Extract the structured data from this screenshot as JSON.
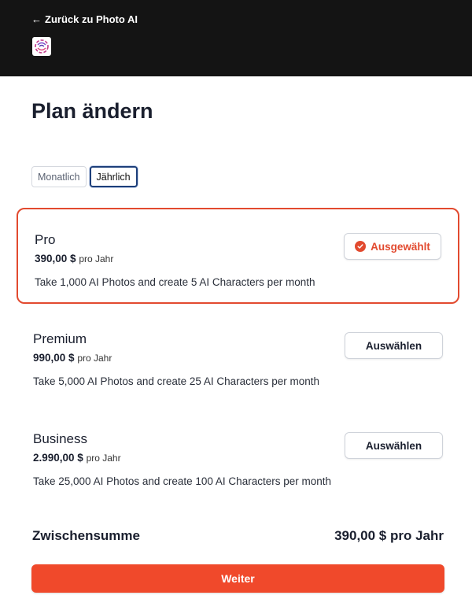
{
  "header": {
    "back_arrow": "←",
    "back_label": "Zurück zu Photo AI",
    "logo_icon": "photo-ai-logo"
  },
  "page": {
    "title": "Plan ändern"
  },
  "billing_toggle": {
    "monthly": "Monatlich",
    "yearly": "Jährlich",
    "selected": "yearly"
  },
  "plans": [
    {
      "name": "Pro",
      "price": "390,00 $",
      "period": "pro Jahr",
      "description": "Take 1,000 AI Photos and create 5 AI Characters per month",
      "button_label": "Ausgewählt",
      "selected": true
    },
    {
      "name": "Premium",
      "price": "990,00 $",
      "period": "pro Jahr",
      "description": "Take 5,000 AI Photos and create 25 AI Characters per month",
      "button_label": "Auswählen",
      "selected": false
    },
    {
      "name": "Business",
      "price": "2.990,00 $",
      "period": "pro Jahr",
      "description": "Take 25,000 AI Photos and create 100 AI Characters per month",
      "button_label": "Auswählen",
      "selected": false
    }
  ],
  "summary": {
    "subtotal_label": "Zwischensumme",
    "subtotal_value": "390,00 $ pro Jahr"
  },
  "actions": {
    "continue_label": "Weiter"
  },
  "colors": {
    "accent": "#f0492b",
    "header_bg": "#141414",
    "text": "#1a1f2e"
  }
}
